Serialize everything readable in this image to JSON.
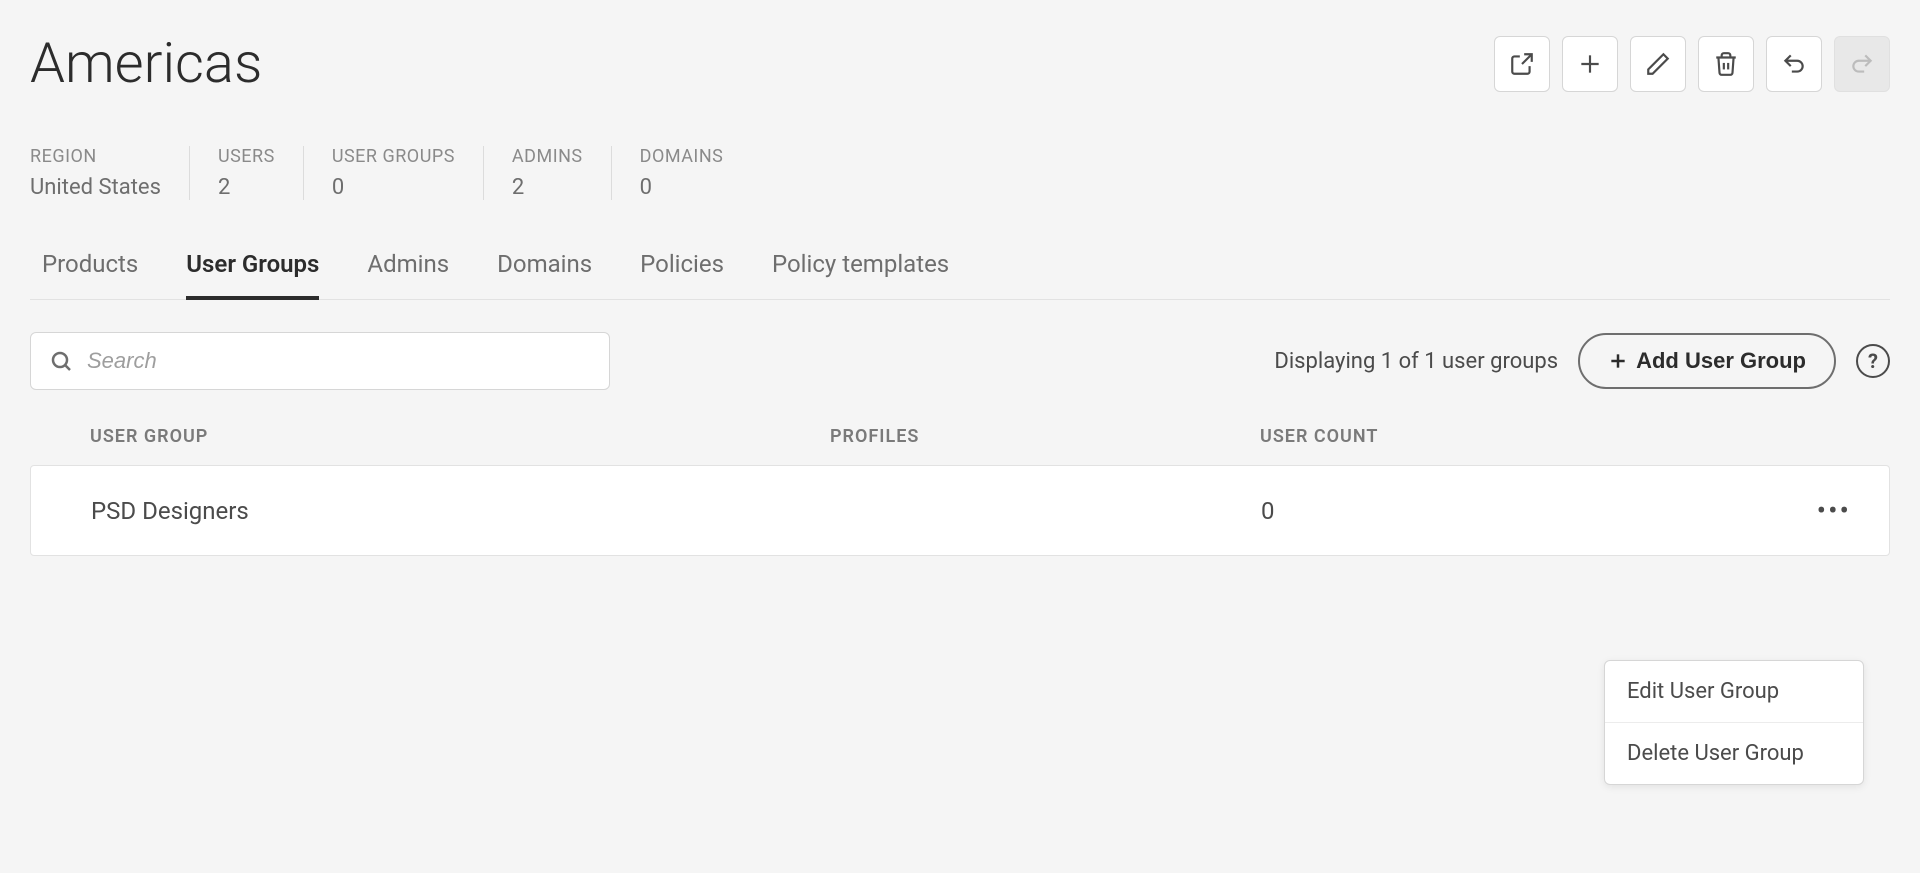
{
  "header": {
    "title": "Americas"
  },
  "stats": [
    {
      "label": "REGION",
      "value": "United States"
    },
    {
      "label": "USERS",
      "value": "2"
    },
    {
      "label": "USER GROUPS",
      "value": "0"
    },
    {
      "label": "ADMINS",
      "value": "2"
    },
    {
      "label": "DOMAINS",
      "value": "0"
    }
  ],
  "tabs": [
    {
      "label": "Products",
      "active": false
    },
    {
      "label": "User Groups",
      "active": true
    },
    {
      "label": "Admins",
      "active": false
    },
    {
      "label": "Domains",
      "active": false
    },
    {
      "label": "Policies",
      "active": false
    },
    {
      "label": "Policy templates",
      "active": false
    }
  ],
  "search": {
    "placeholder": "Search"
  },
  "result_text": "Displaying 1 of 1 user groups",
  "add_button": "Add User Group",
  "help_glyph": "?",
  "table": {
    "columns": {
      "name": "USER GROUP",
      "profiles": "PROFILES",
      "count": "USER COUNT"
    },
    "rows": [
      {
        "name": "PSD Designers",
        "profiles": "",
        "count": "0"
      }
    ]
  },
  "dropdown": {
    "edit": "Edit User Group",
    "delete": "Delete User Group"
  },
  "more_glyph": "•••"
}
